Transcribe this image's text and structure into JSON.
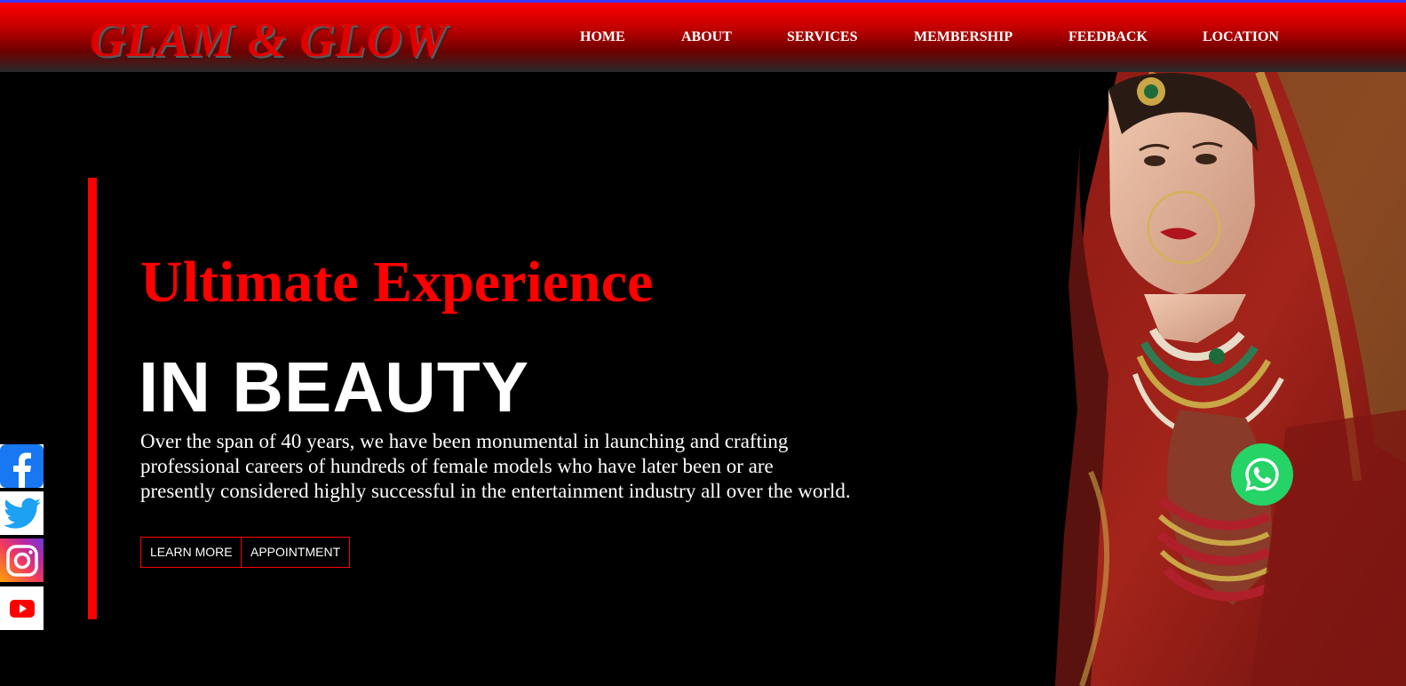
{
  "header": {
    "logo": "GLAM & GLOW",
    "nav": [
      "HOME",
      "ABOUT",
      "SERVICES",
      "MEMBERSHIP",
      "FEEDBACK",
      "LOCATION"
    ]
  },
  "hero": {
    "headline": "Ultimate Experience",
    "subhead": "IN BEAUTY",
    "description": "Over the span of 40 years, we have been monumental in launching and crafting professional careers of hundreds of female models who have later been or are presently considered highly successful in the entertainment industry all over the world.",
    "learn_more": "LEARN MORE",
    "appointment": "APPOINTMENT"
  },
  "social": [
    "facebook-icon",
    "twitter-icon",
    "instagram-icon",
    "youtube-icon"
  ],
  "colors": {
    "accent": "#ff0000",
    "background": "#000000",
    "whatsapp": "#25d366"
  }
}
